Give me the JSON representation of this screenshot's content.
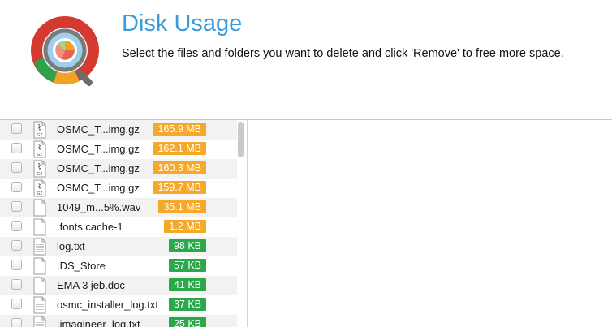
{
  "header": {
    "title": "Disk Usage",
    "subtitle": "Select the files and folders you want to delete and click 'Remove' to free more space."
  },
  "colors": {
    "title": "#3d9bdc",
    "size_large": "#f6a82b",
    "size_small": "#2aa84a"
  },
  "files": [
    {
      "name": "OSMC_T...img.gz",
      "size": "165.9 MB",
      "level": "large",
      "icon": "gz-file-icon",
      "ext": "GZ"
    },
    {
      "name": "OSMC_T...img.gz",
      "size": "162.1 MB",
      "level": "large",
      "icon": "gz-file-icon",
      "ext": "GZ"
    },
    {
      "name": "OSMC_T...img.gz",
      "size": "160.3 MB",
      "level": "large",
      "icon": "gz-file-icon",
      "ext": "GZ"
    },
    {
      "name": "OSMC_T...img.gz",
      "size": "159.7 MB",
      "level": "large",
      "icon": "gz-file-icon",
      "ext": "GZ"
    },
    {
      "name": "1049_m...5%.wav",
      "size": "35.1 MB",
      "level": "large",
      "icon": "file-icon",
      "ext": ""
    },
    {
      "name": ".fonts.cache-1",
      "size": "1.2 MB",
      "level": "large",
      "icon": "file-icon",
      "ext": ""
    },
    {
      "name": "log.txt",
      "size": "98 KB",
      "level": "small",
      "icon": "text-file-icon",
      "ext": ""
    },
    {
      "name": ".DS_Store",
      "size": "57 KB",
      "level": "small",
      "icon": "file-icon",
      "ext": ""
    },
    {
      "name": "EMA 3 jeb.doc",
      "size": "41 KB",
      "level": "small",
      "icon": "file-icon",
      "ext": ""
    },
    {
      "name": "osmc_installer_log.txt",
      "size": "37 KB",
      "level": "small",
      "icon": "text-file-icon",
      "ext": ""
    },
    {
      "name": ".imagineer_log.txt",
      "size": "25 KB",
      "level": "small",
      "icon": "text-file-icon",
      "ext": ""
    }
  ]
}
